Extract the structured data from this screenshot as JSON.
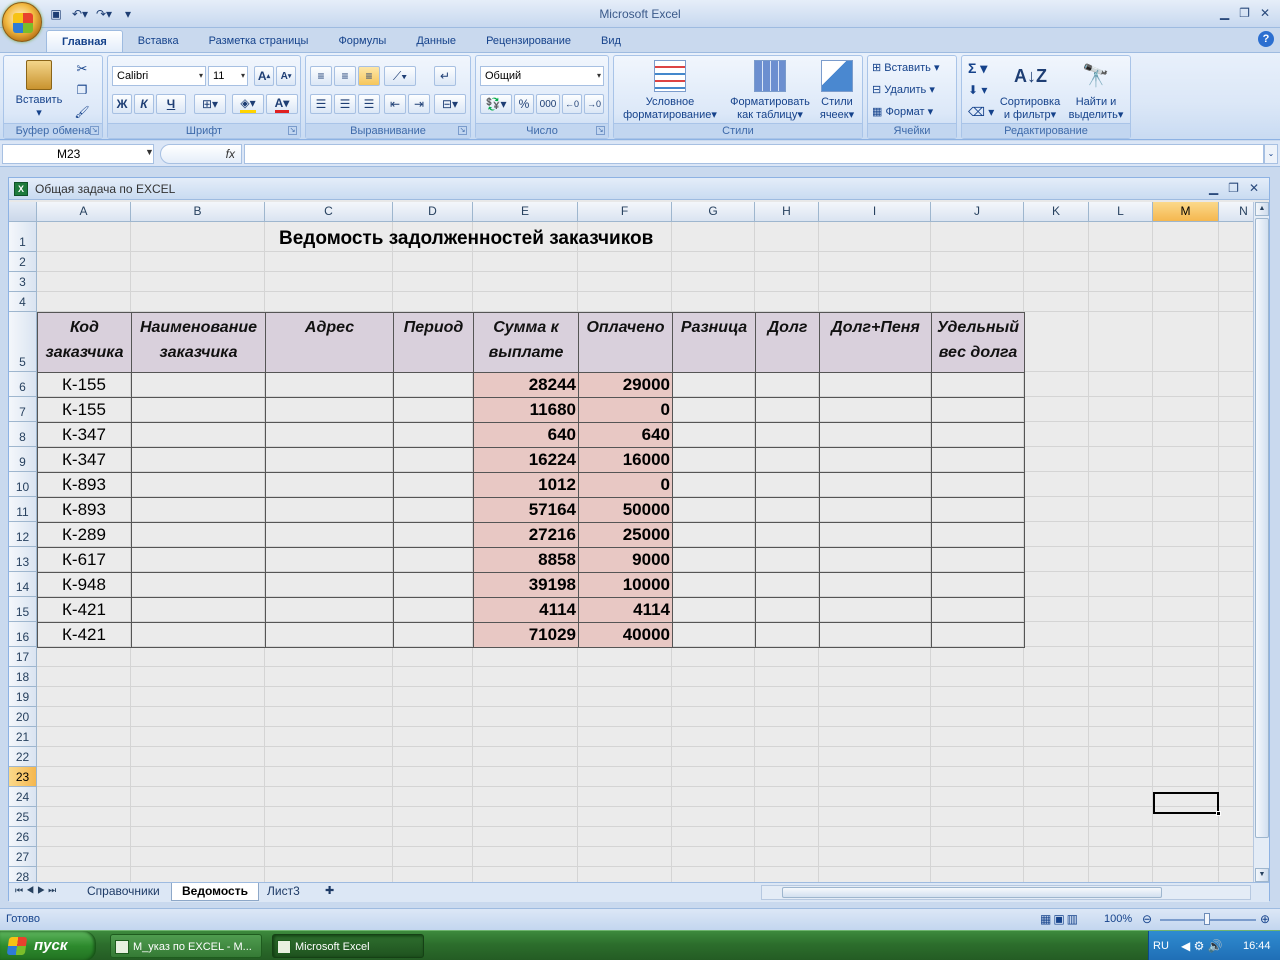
{
  "app": {
    "title": "Microsoft Excel"
  },
  "ribbon": {
    "tabs": [
      "Главная",
      "Вставка",
      "Разметка страницы",
      "Формулы",
      "Данные",
      "Рецензирование",
      "Вид"
    ],
    "clipboard": {
      "paste": "Вставить",
      "label": "Буфер обмена"
    },
    "font": {
      "name": "Calibri",
      "size": "11",
      "bold": "Ж",
      "italic": "К",
      "underline": "Ч",
      "label": "Шрифт"
    },
    "alignment": {
      "label": "Выравнивание"
    },
    "number": {
      "format": "Общий",
      "label": "Число",
      "percent": "%",
      "thousands": "000"
    },
    "styles": {
      "cond_format": "Условное форматирование",
      "format_table": "Форматировать как таблицу",
      "cell_styles": "Стили ячеек",
      "label": "Стили"
    },
    "cells": {
      "insert": "Вставить",
      "delete": "Удалить",
      "format": "Формат",
      "label": "Ячейки"
    },
    "editing": {
      "sort": "Сортировка и фильтр",
      "find": "Найти и выделить",
      "label": "Редактирование"
    }
  },
  "formula_bar": {
    "name_box": "M23",
    "fx": "fx",
    "value": ""
  },
  "workbook": {
    "title": "Общая задача по EXCEL"
  },
  "sheet": {
    "columns": [
      "A",
      "B",
      "C",
      "D",
      "E",
      "F",
      "G",
      "H",
      "I",
      "J",
      "K",
      "L",
      "M",
      "N"
    ],
    "selected_column": "M",
    "rows": [
      "1",
      "2",
      "3",
      "4",
      "5",
      "6",
      "7",
      "8",
      "9",
      "10",
      "11",
      "12",
      "13",
      "14",
      "15",
      "16",
      "17",
      "18",
      "19",
      "20",
      "21",
      "22",
      "23",
      "24",
      "25",
      "26",
      "27",
      "28"
    ],
    "selected_row": "23",
    "title": "Ведомость задолженностей заказчиков",
    "headers": [
      {
        "l1": "Код",
        "l2": "заказчика"
      },
      {
        "l1": "Наименование",
        "l2": "заказчика"
      },
      {
        "l1": "Адрес",
        "l2": ""
      },
      {
        "l1": "Период",
        "l2": ""
      },
      {
        "l1": "Сумма к",
        "l2": "выплате"
      },
      {
        "l1": "Оплачено",
        "l2": ""
      },
      {
        "l1": "Разница",
        "l2": ""
      },
      {
        "l1": "Долг",
        "l2": ""
      },
      {
        "l1": "Долг+Пеня",
        "l2": ""
      },
      {
        "l1": "Удельный",
        "l2": "вес долга"
      }
    ],
    "data": [
      {
        "code": "К-155",
        "sum": "28244",
        "paid": "29000"
      },
      {
        "code": "К-155",
        "sum": "11680",
        "paid": "0"
      },
      {
        "code": "К-347",
        "sum": "640",
        "paid": "640"
      },
      {
        "code": "К-347",
        "sum": "16224",
        "paid": "16000"
      },
      {
        "code": "К-893",
        "sum": "1012",
        "paid": "0"
      },
      {
        "code": "К-893",
        "sum": "57164",
        "paid": "50000"
      },
      {
        "code": "К-289",
        "sum": "27216",
        "paid": "25000"
      },
      {
        "code": "К-617",
        "sum": "8858",
        "paid": "9000"
      },
      {
        "code": "К-948",
        "sum": "39198",
        "paid": "10000"
      },
      {
        "code": "К-421",
        "sum": "4114",
        "paid": "4114"
      },
      {
        "code": "К-421",
        "sum": "71029",
        "paid": "40000"
      }
    ],
    "tabs": [
      "Справочники",
      "Ведомость",
      "Лист3"
    ],
    "active_tab": "Ведомость"
  },
  "status": {
    "text": "Готово",
    "zoom": "100%"
  },
  "taskbar": {
    "start": "пуск",
    "items": [
      "M_указ по EXCEL - M...",
      "Microsoft Excel"
    ],
    "lang": "RU",
    "time": "16:44"
  },
  "colors": {
    "header_fill": "#d9d0dc",
    "number_fill": "#e8c8c4",
    "ribbon": "#dbe7f7",
    "taskbar": "#2c6e2c"
  }
}
